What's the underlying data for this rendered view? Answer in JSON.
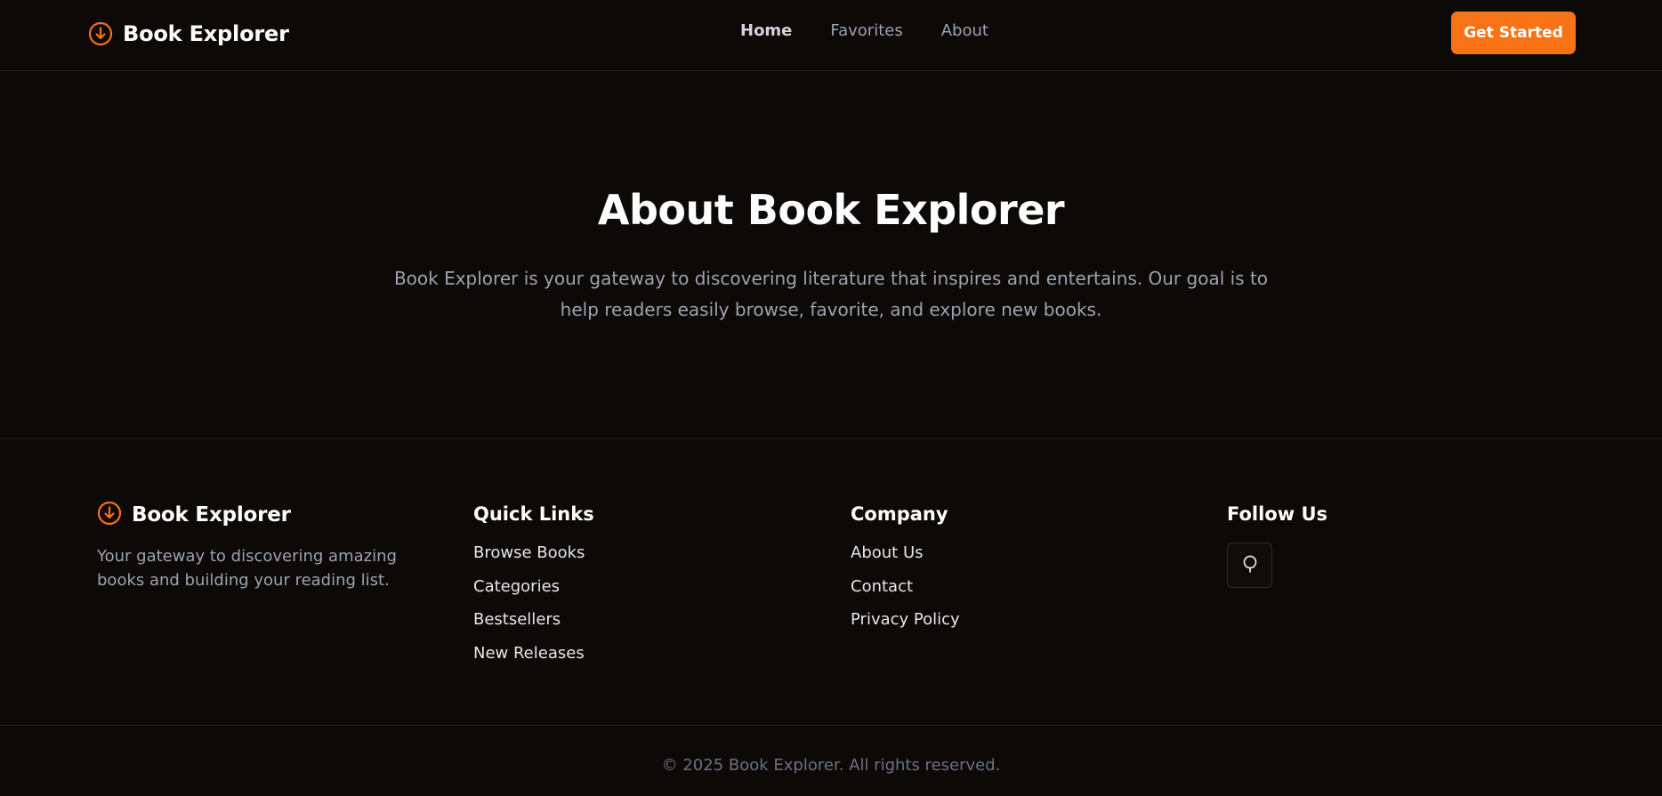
{
  "header": {
    "brand": "Book Explorer",
    "nav": [
      {
        "label": "Home",
        "active": true
      },
      {
        "label": "Favorites",
        "active": false
      },
      {
        "label": "About",
        "active": false
      }
    ],
    "cta_label": "Get Started"
  },
  "hero": {
    "title": "About Book Explorer",
    "text": "Book Explorer is your gateway to discovering literature that inspires and entertains. Our goal is to help readers easily browse, favorite, and explore new books."
  },
  "footer": {
    "brand": "Book Explorer",
    "tagline": "Your gateway to discovering amazing books and building your reading list.",
    "quick_links": {
      "heading": "Quick Links",
      "items": [
        "Browse Books",
        "Categories",
        "Bestsellers",
        "New Releases"
      ]
    },
    "company": {
      "heading": "Company",
      "items": [
        "About Us",
        "Contact",
        "Privacy Policy"
      ]
    },
    "follow": {
      "heading": "Follow Us",
      "social_icon": "social-icon"
    },
    "copyright": "© 2025 Book Explorer. All rights reserved."
  },
  "colors": {
    "accent": "#f97316",
    "background": "#0c0907",
    "muted_text": "#9ca3af",
    "border": "#1d222b"
  }
}
